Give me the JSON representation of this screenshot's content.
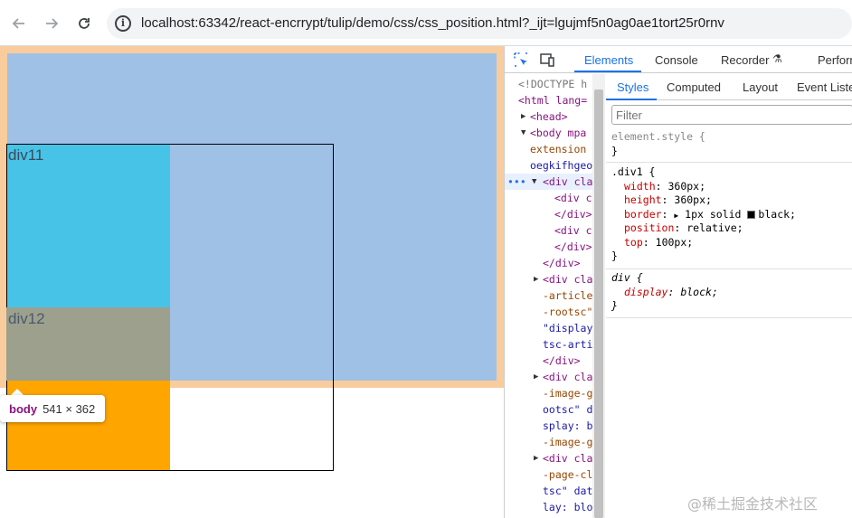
{
  "browser": {
    "url": "localhost:63342/react-encrrypt/tulip/demo/css/css_position.html?_ijt=lgujmf5n0ag0ae1tort25r0rnv",
    "back_icon": "arrow-left-icon",
    "forward_icon": "arrow-right-icon",
    "reload_icon": "reload-icon"
  },
  "page": {
    "div11_label": "div11",
    "div12_label": "div12",
    "tooltip_tag": "body",
    "tooltip_dims": "541 × 362"
  },
  "devtools": {
    "tabs": [
      "Elements",
      "Console",
      "Recorder",
      "Perform"
    ],
    "active_tab": "Elements",
    "styles_tabs": [
      "Styles",
      "Computed",
      "Layout",
      "Event Liste"
    ],
    "filter_placeholder": "Filter",
    "elements_lines": [
      "<!DOCTYPE h",
      "<html lang=",
      "<head>",
      "<body mpa",
      "extension",
      "oegkifhgeo",
      "<div cla",
      "<div c",
      "</div>",
      "<div c",
      "</div>",
      "</div>",
      "<div cla",
      "-article",
      "-rootsc\"",
      "\"display",
      "tsc-arti",
      "</div>",
      "<div cla",
      "-image-g",
      "ootsc\" d",
      "splay: b",
      "-image-g",
      "<div cla",
      "-page-cl",
      "tsc\" dat",
      "lay: blo"
    ],
    "rules": {
      "element_style": "element.style {",
      "close": "}",
      "div1_selector": ".div1 {",
      "width": "360px;",
      "height": "360px;",
      "border": "1px solid",
      "border_color": "black;",
      "position": "relative;",
      "top": "100px;",
      "div_selector": "div {",
      "display": "block;"
    }
  },
  "watermark": "@稀土掘金技术社区",
  "colors": {
    "body_margin": "#f9cc9d",
    "body_content": "#9fc1e6",
    "div11": "#48c3e8",
    "div12": "#ffa500",
    "accent": "#1a73e8"
  }
}
